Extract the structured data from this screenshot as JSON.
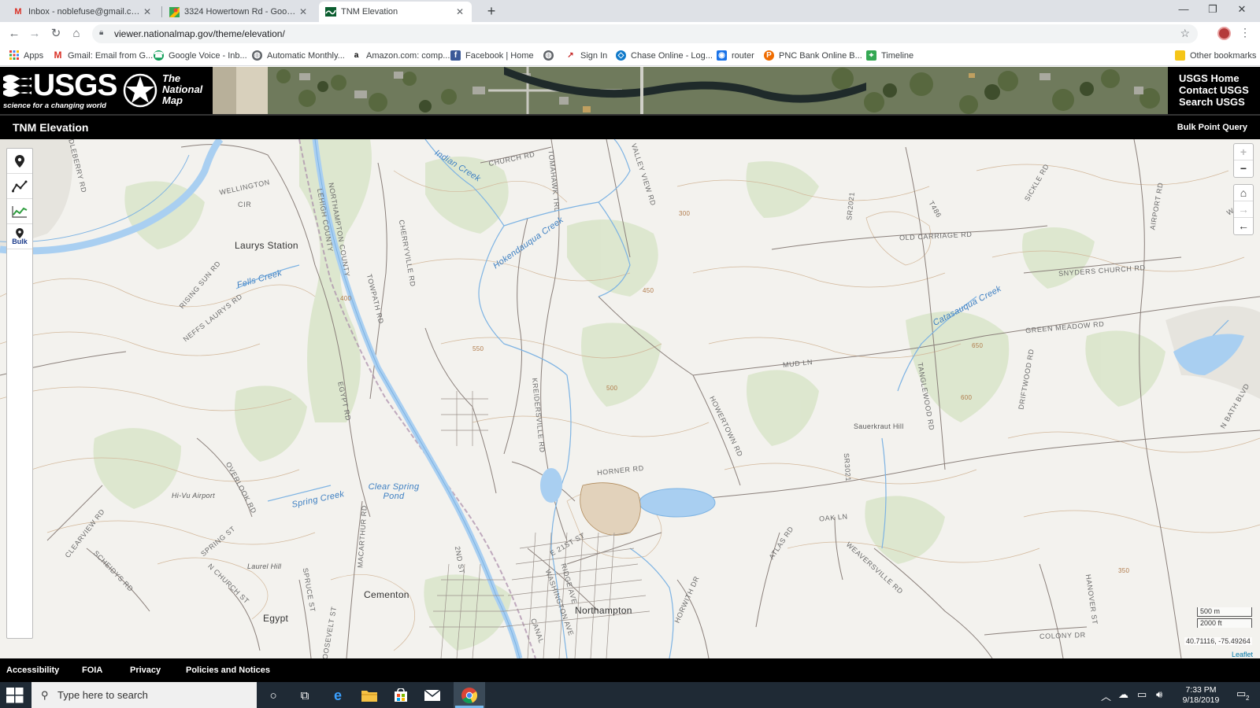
{
  "browser": {
    "tabs": [
      {
        "title": "Inbox - noblefuse@gmail.com - Gmail",
        "icon": "gmail-icon"
      },
      {
        "title": "3324 Howertown Rd - Google Maps",
        "icon": "google-maps-icon"
      },
      {
        "title": "TNM Elevation",
        "icon": "usgs-tnm-icon"
      }
    ],
    "url": "viewer.nationalmap.gov/theme/elevation/",
    "bookmarks": [
      {
        "label": "Apps",
        "icon": "apps-grid-icon"
      },
      {
        "label": "Gmail: Email from G...",
        "icon": "gmail-icon"
      },
      {
        "label": "Google Voice - Inb...",
        "icon": "google-voice-icon"
      },
      {
        "label": "Automatic Monthly...",
        "icon": "globe-icon"
      },
      {
        "label": "Amazon.com: comp...",
        "icon": "amazon-icon"
      },
      {
        "label": "Facebook | Home",
        "icon": "facebook-icon"
      },
      {
        "label": "",
        "icon": "globe-icon"
      },
      {
        "label": "Sign In",
        "icon": "sign-in-icon"
      },
      {
        "label": "Chase Online - Log...",
        "icon": "chase-icon"
      },
      {
        "label": "router",
        "icon": "router-icon"
      },
      {
        "label": "PNC Bank Online B...",
        "icon": "pnc-icon"
      },
      {
        "label": "Timeline",
        "icon": "google-maps-icon"
      }
    ],
    "other_bookmarks": "Other bookmarks"
  },
  "usgs": {
    "wordmark": "USGS",
    "tagline": "science for a changing world",
    "tnm_words": [
      "The",
      "National",
      "Map"
    ],
    "links": [
      "USGS Home",
      "Contact USGS",
      "Search USGS"
    ]
  },
  "app": {
    "title": "TNM Elevation",
    "bulk_point_query": "Bulk Point Query"
  },
  "map": {
    "tools": [
      {
        "name": "point-tool",
        "icon": "map-pin-icon",
        "label": ""
      },
      {
        "name": "profile-tool",
        "icon": "line-profile-icon",
        "label": ""
      },
      {
        "name": "elevation-chart-tool",
        "icon": "elevation-chart-icon",
        "label": ""
      },
      {
        "name": "bulk-tool",
        "icon": "map-pin-icon",
        "label": "Bulk"
      }
    ],
    "zoom": {
      "in": "+",
      "out": "−"
    },
    "nav": {
      "home": "⌂",
      "forward": "→",
      "back": "←"
    },
    "labels": {
      "places": [
        "Laurys Station",
        "Cementon",
        "Northampton",
        "Egypt",
        "Sauerkraut Hill",
        "Laurel Hill",
        "Hi-Vu Airport"
      ],
      "water": [
        "Indian Creek",
        "Hokendauqua Creek",
        "Fells Creek",
        "Catasauqua Creek",
        "Spring Creek",
        "Clear Spring Pond"
      ],
      "roads": [
        "CHURCH RD",
        "WELLINGTON",
        "CIR",
        "NORTHAMPTON COUNTY",
        "LEHIGH COUNTY",
        "TOWPATH RD",
        "CHERRYVILLE RD",
        "RISING SUN RD",
        "NEFFS LAURYS RD",
        "EGYPT RD",
        "MACARTHUR RD",
        "HORNER RD",
        "HOWERTOWN RD",
        "MUD LN",
        "OLD CARRIAGE RD",
        "SNYDERS CHURCH RD",
        "GREEN MEADOW RD",
        "DRIFTWOOD RD",
        "TANGLEWOOD RD",
        "OAK LN",
        "WEAVERSVILLE RD",
        "HANOVER ST",
        "COLONY DR",
        "AIRPORT RD",
        "N BATH BLVD",
        "E 21ST ST",
        "VALLEY VIEW RD",
        "TOMAHAWK TRL",
        "SR2021",
        "SR3021",
        "OVERLOOK RD",
        "SPRING ST",
        "N CHURCH ST",
        "SPRUCE ST",
        "CLEARVIEW RD",
        "SCHEIDYS RD",
        "ROOSEVELT ST",
        "WASHINGTON AVE",
        "KREIDERSVILLE RD",
        "W MAIN",
        "SICKLE RD",
        "T486",
        "ATLAS RD",
        "HORWITH DR",
        "CANAL",
        "RIDGE AVE",
        "MIDDLEBERRY RD",
        "2ND ST"
      ],
      "elevations": [
        "550",
        "450",
        "500",
        "400",
        "600",
        "650",
        "350",
        "300"
      ]
    },
    "scale": {
      "metric": "500 m",
      "imperial": "2000 ft"
    },
    "coordinates": "40.71116, -75.49264",
    "attribution": "Leaflet"
  },
  "footer": {
    "links": [
      "Accessibility",
      "FOIA",
      "Privacy",
      "Policies and Notices"
    ]
  },
  "taskbar": {
    "search_placeholder": "Type here to search",
    "time": "7:33 PM",
    "date": "9/18/2019",
    "notification_count": "2"
  }
}
